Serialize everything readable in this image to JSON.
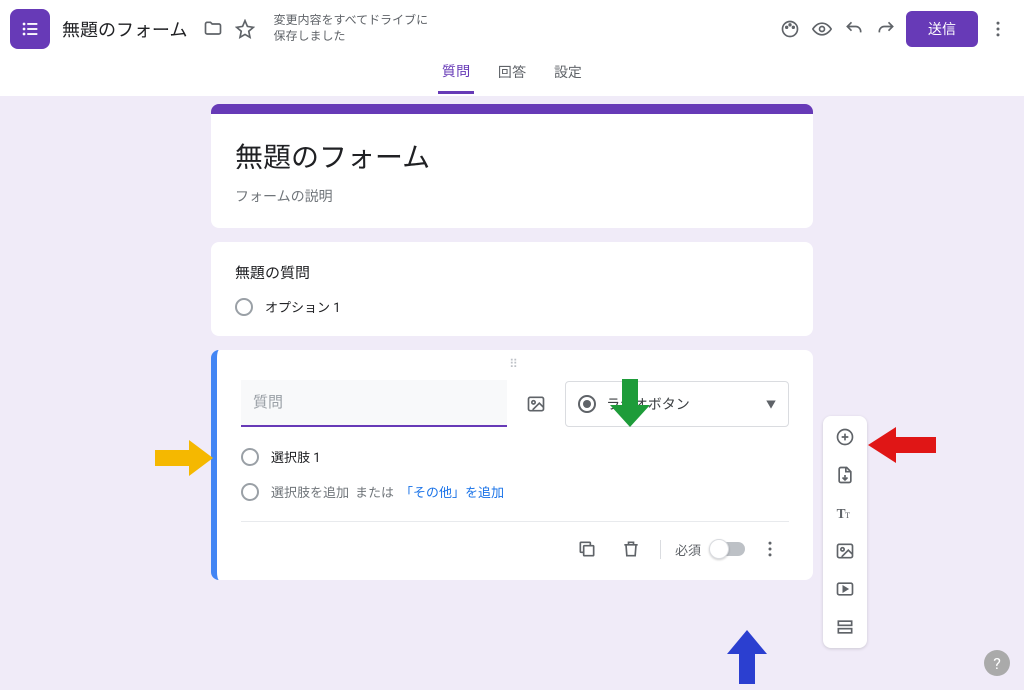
{
  "header": {
    "title": "無題のフォーム",
    "save_status": "変更内容をすべてドライブに保存しました",
    "send_label": "送信"
  },
  "tabs": {
    "questions": "質問",
    "responses": "回答",
    "settings": "設定",
    "active": "questions"
  },
  "title_card": {
    "title": "無題のフォーム",
    "desc": "フォームの説明"
  },
  "question1": {
    "title": "無題の質問",
    "option1": "オプション 1"
  },
  "question2": {
    "input_placeholder": "質問",
    "type_label": "ラジオボタン",
    "option1": "選択肢 1",
    "add_option": "選択肢を追加",
    "or": "または",
    "add_other": "「その他」を追加",
    "required_label": "必須"
  },
  "colors": {
    "accent": "#673ab7"
  },
  "annotations": {
    "arrows": [
      "yellow-right",
      "green-down",
      "red-left",
      "blue-up"
    ]
  }
}
